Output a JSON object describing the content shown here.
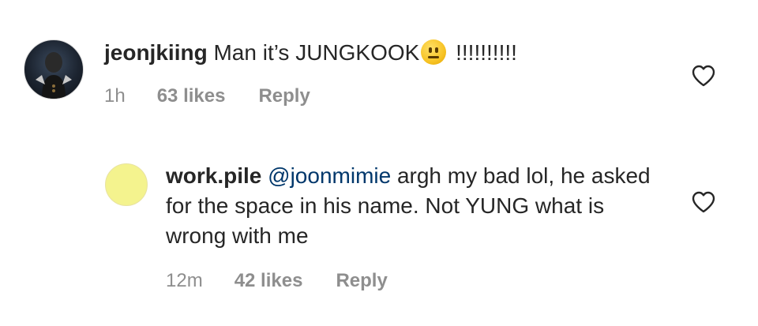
{
  "comments": [
    {
      "username": "jeonjkiing",
      "text_before_emoji": "Man it’s JUNGKOOK",
      "emoji": "neutral-face-emoji",
      "text_after_emoji": " !!!!!!!!!!",
      "time": "1h",
      "likes": "63 likes",
      "reply_label": "Reply"
    },
    {
      "username": "work.pile",
      "mention": "@joonmimie",
      "text": " argh my bad lol, he asked for the space in his name. Not YUNG what is wrong with me",
      "time": "12m",
      "likes": "42 likes",
      "reply_label": "Reply"
    }
  ],
  "colors": {
    "text": "#262626",
    "meta": "#8e8e8e",
    "mention": "#00376b",
    "avatar2": "#f4f38e"
  }
}
